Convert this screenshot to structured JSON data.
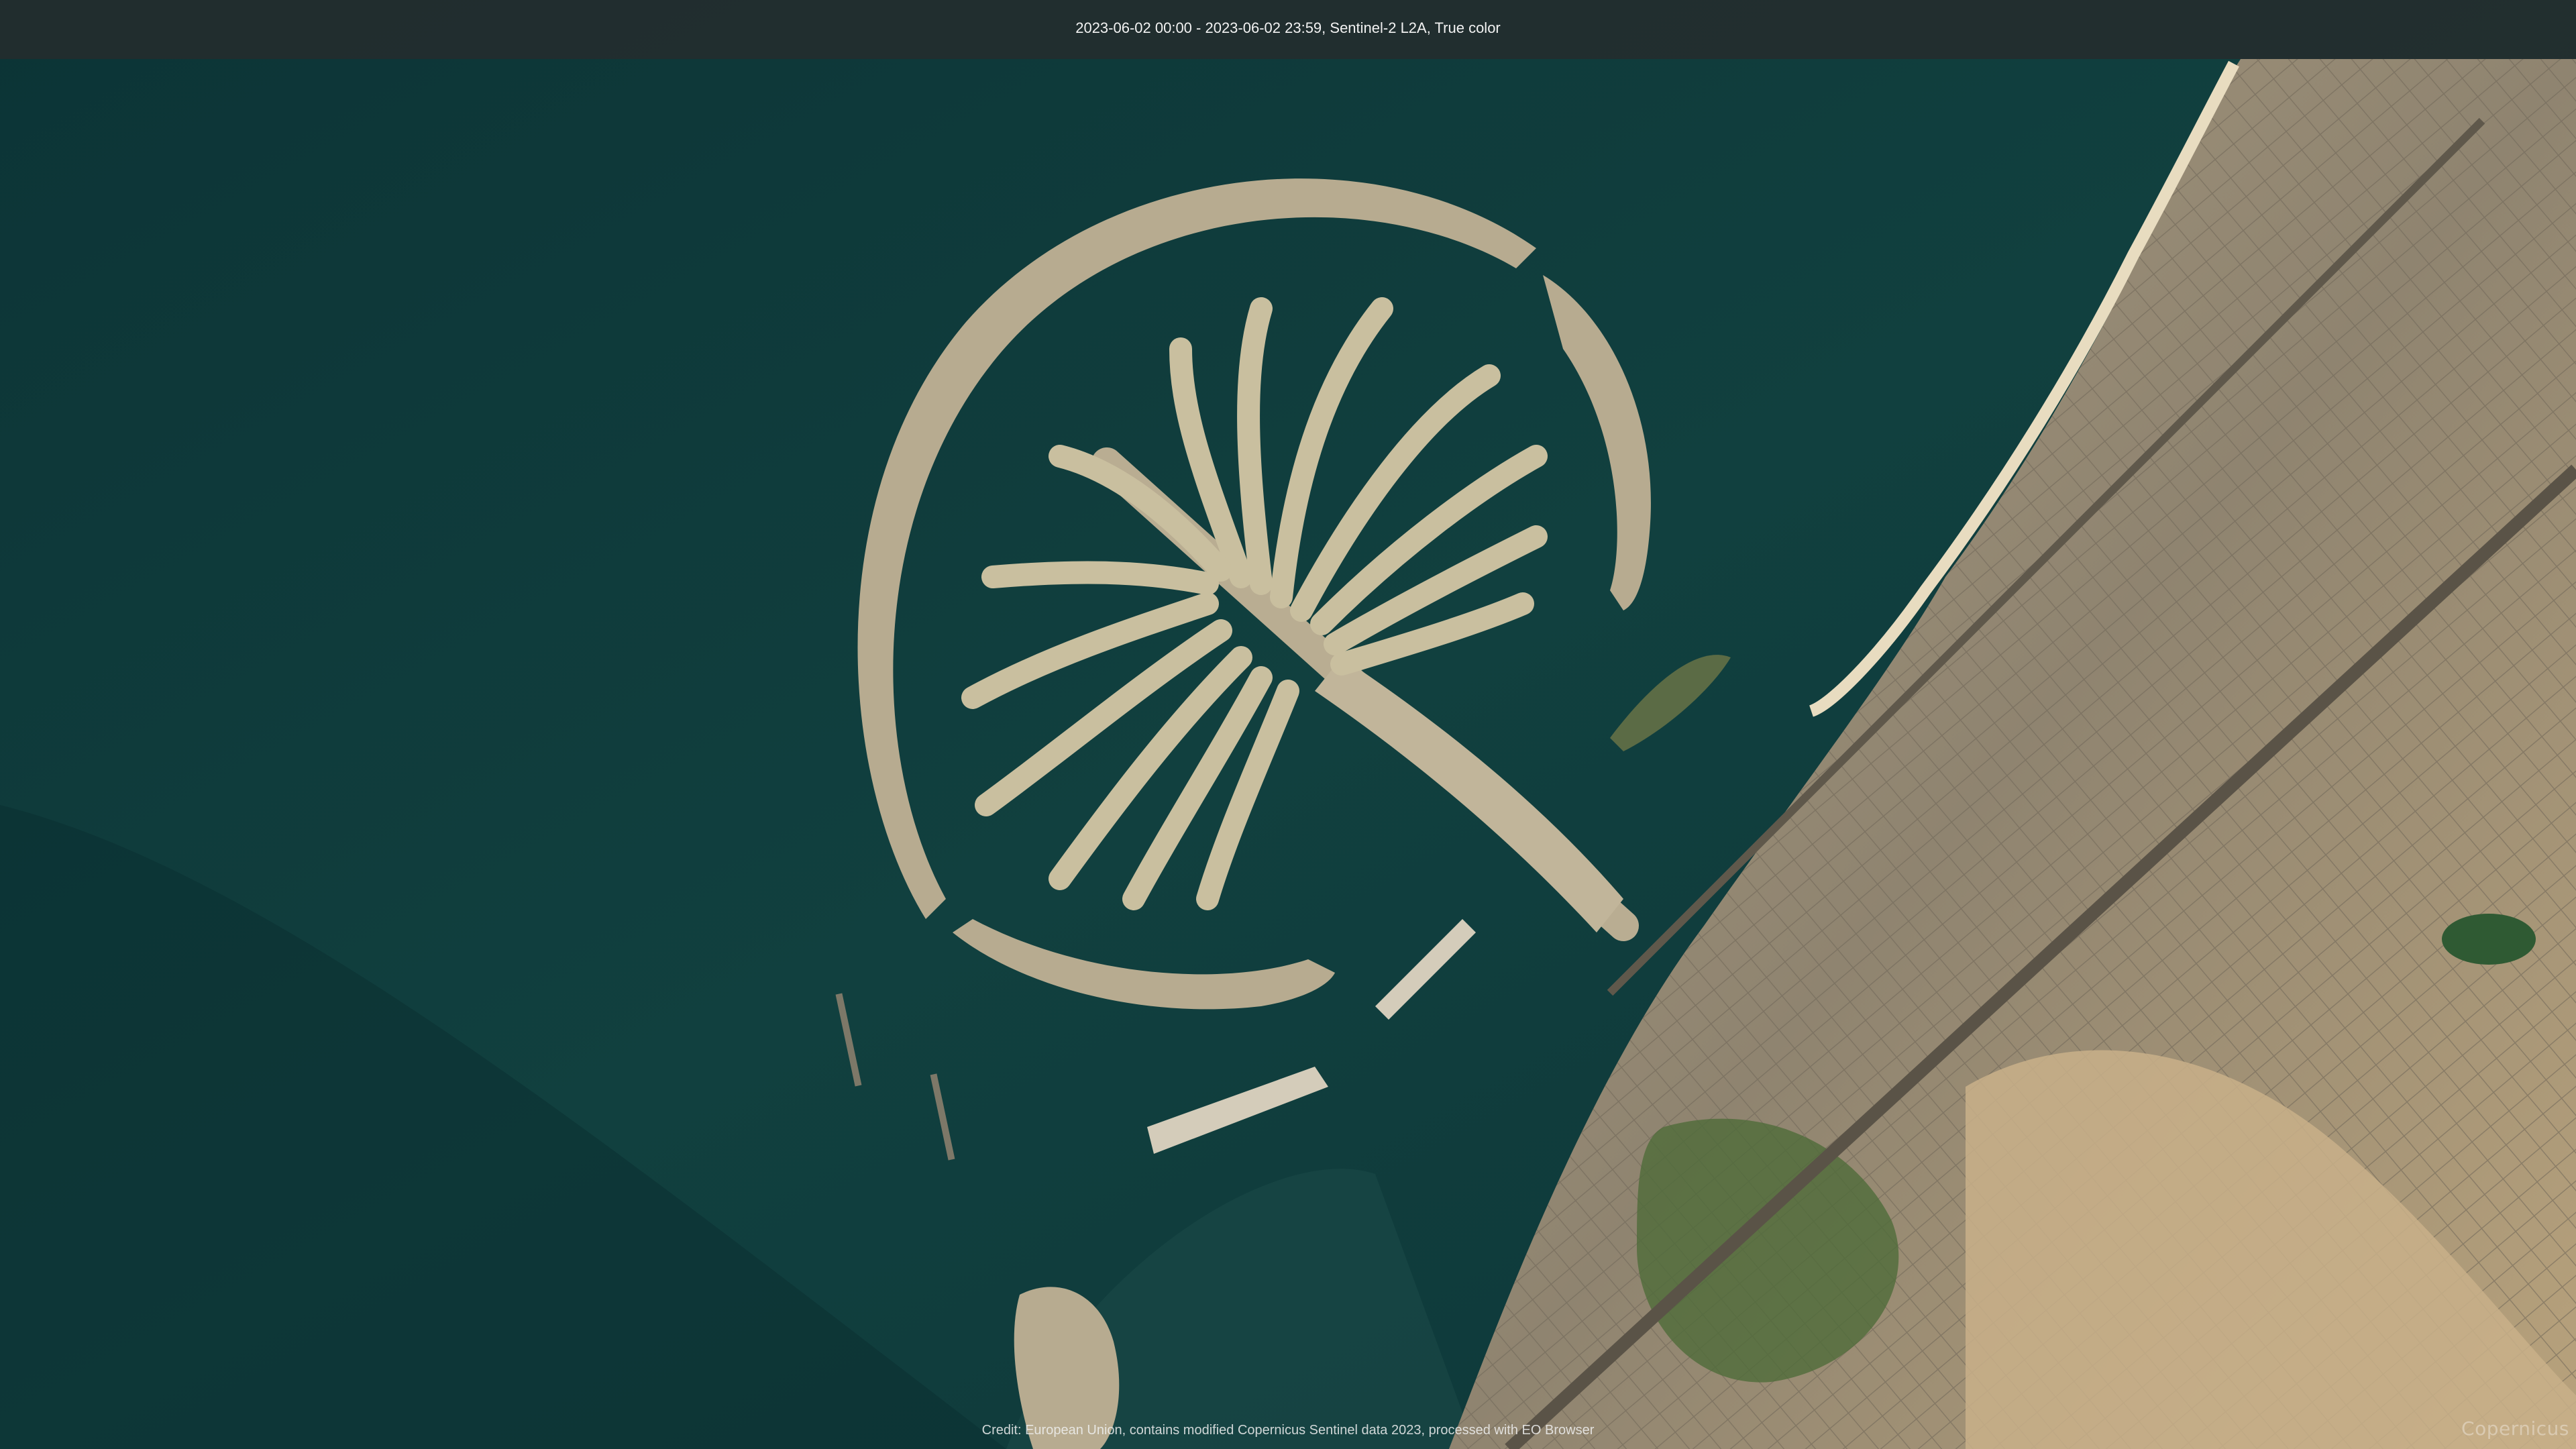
{
  "header": {
    "caption": "2023-06-02 00:00 - 2023-06-02 23:59, Sentinel-2 L2A, True color"
  },
  "footer": {
    "credit": "Credit: European Union, contains modified Copernicus Sentinel data 2023, processed with EO Browser"
  },
  "logo": {
    "text": "Copernicus"
  },
  "colors": {
    "sea": "#0f3a3c",
    "lagoon": "#14393b",
    "land_sand": "#c9b894",
    "land_urban": "#8c8270",
    "island_built": "#b7ab90",
    "vegetation": "#4f6b3a"
  }
}
